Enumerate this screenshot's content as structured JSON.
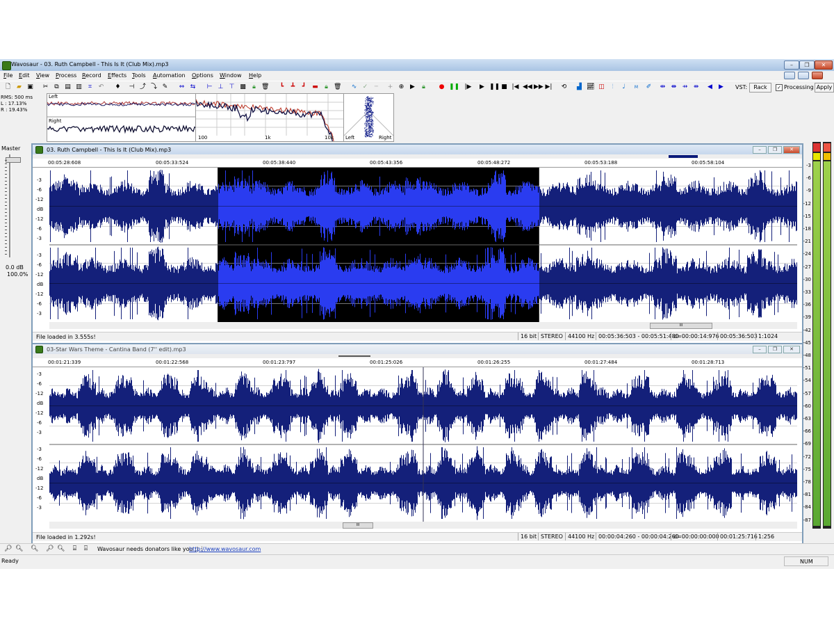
{
  "app": {
    "title": "Wavosaur - 03. Ruth Campbell - This Is It (Club Mix).mp3"
  },
  "menu": [
    "File",
    "Edit",
    "View",
    "Process",
    "Record",
    "Effects",
    "Tools",
    "Automation",
    "Options",
    "Window",
    "Help"
  ],
  "toolbar": {
    "vst_label": "VST:",
    "rack_label": "Rack",
    "processing_label": "Processing",
    "processing_checked": true,
    "apply_label": "Apply"
  },
  "analyzer": {
    "rms": "RMS: 500 ms",
    "left_pct": "L : 17.13%",
    "right_pct": "R : 19.43%",
    "left_label": "Left",
    "right_label": "Right",
    "spectrum_ticks": [
      "100",
      "1k",
      "10k"
    ],
    "scope_left": "Left",
    "scope_right": "Right"
  },
  "master": {
    "label": "Master",
    "db": "0.0 dB",
    "pct": "100.0%"
  },
  "doc1": {
    "title": "03. Ruth Campbell - This Is It (Club Mix).mp3",
    "ticks": [
      "00:05:28:608",
      "00:05:33:524",
      "00:05:38:440",
      "00:05:43:356",
      "00:05:48:272",
      "00:05:53:188",
      "00:05:58:104"
    ],
    "scale": [
      "-3",
      "-6",
      "-12",
      "dB",
      "-12",
      "-6",
      "-3"
    ],
    "status_text": "File loaded in 3.555s!",
    "bits": "16 bit",
    "mode": "STEREO",
    "rate": "44100 Hz",
    "range": "00:05:36:503 - 00:05:51:480",
    "duration": "d=00:00:14:976",
    "position": "00:05:36:503",
    "zoom": "1:1024",
    "selection_start": 0.225,
    "selection_end": 0.655
  },
  "doc2": {
    "title": "03-Star Wars Theme - Cantina Band (7'' edit).mp3",
    "ticks": [
      "00:01:21:339",
      "00:01:22:568",
      "00:01:23:797",
      "00:01:25:026",
      "00:01:26:255",
      "00:01:27:484",
      "00:01:28:713"
    ],
    "scale": [
      "-3",
      "-6",
      "-12",
      "dB",
      "-12",
      "-6",
      "-3"
    ],
    "status_text": "File loaded in 1.292s!",
    "bits": "16 bit",
    "mode": "STEREO",
    "rate": "44100 Hz",
    "range": "00:00:04:260 - 00:00:04:260",
    "duration": "d=00:00:00:000",
    "position": "00:01:25:716",
    "zoom": "1:256"
  },
  "vu_scale": [
    "-3",
    "-6",
    "-9",
    "-12",
    "-15",
    "-18",
    "-21",
    "-24",
    "-27",
    "-30",
    "-33",
    "-36",
    "-39",
    "-42",
    "-45",
    "-48",
    "-51",
    "-54",
    "-57",
    "-60",
    "-63",
    "-66",
    "-69",
    "-72",
    "-75",
    "-78",
    "-81",
    "-84",
    "-87"
  ],
  "bottom": {
    "donate_text": "Wavosaur needs donators like you ;)",
    "link_text": "http://www.wavosaur.com"
  },
  "statusbar": {
    "ready": "Ready",
    "num": "NUM"
  }
}
